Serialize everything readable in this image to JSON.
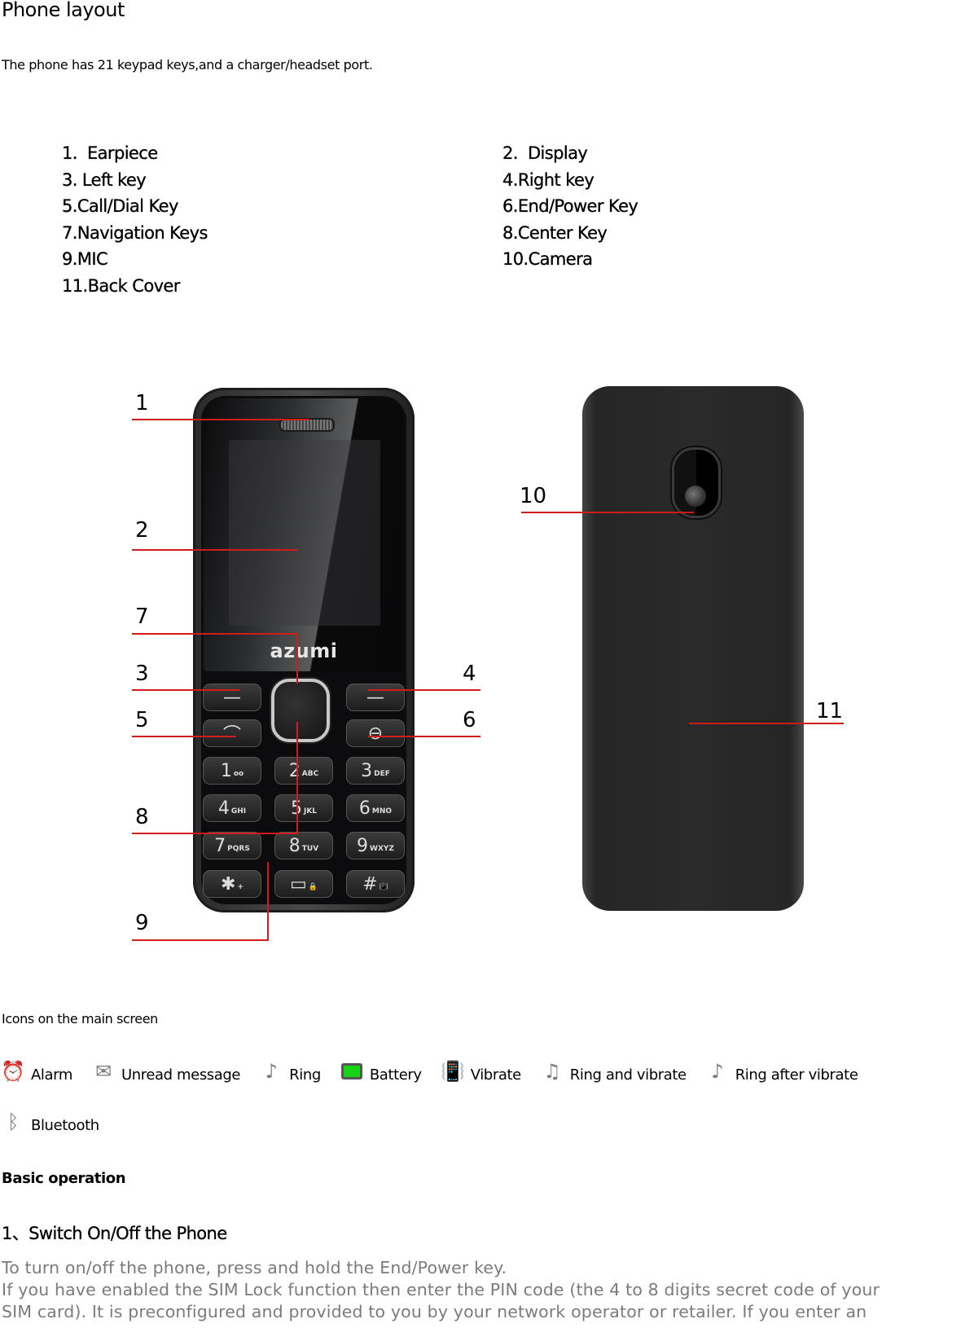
{
  "header": {
    "title": "Phone layout",
    "intro": "The phone has 21 keypad keys,and a charger/headset port."
  },
  "parts": {
    "left": [
      "1.  Earpiece",
      "3. Left key",
      "5.Call/Dial Key",
      "7.Navigation Keys",
      "9.MIC",
      "11.Back Cover"
    ],
    "right": [
      "2.  Display",
      "4.Right key",
      "6.End/Power Key",
      "8.Center Key",
      "10.Camera"
    ]
  },
  "figure": {
    "brand": "azumi",
    "callouts": [
      "1",
      "2",
      "7",
      "3",
      "4",
      "5",
      "6",
      "8",
      "9",
      "10",
      "11"
    ],
    "callout_color": "#d21c1c",
    "soft_keys": {
      "left_symbol": "—",
      "right_symbol": "—",
      "call_symbol": "⌒",
      "end_symbol": "⊖"
    },
    "keypad": [
      {
        "digit": "1",
        "letters": "oo"
      },
      {
        "digit": "2",
        "letters": "ABC"
      },
      {
        "digit": "3",
        "letters": "DEF"
      },
      {
        "digit": "4",
        "letters": "GHI"
      },
      {
        "digit": "5",
        "letters": "JKL"
      },
      {
        "digit": "6",
        "letters": "MNO"
      },
      {
        "digit": "7",
        "letters": "PQRS"
      },
      {
        "digit": "8",
        "letters": "TUV"
      },
      {
        "digit": "9",
        "letters": "WXYZ"
      },
      {
        "digit": "✱",
        "letters": "+"
      },
      {
        "digit": "▭",
        "letters": "🔒"
      },
      {
        "digit": "#",
        "letters": "📳"
      }
    ]
  },
  "icons_section": {
    "heading": "Icons on the main screen",
    "items": [
      {
        "icon": "alarm-icon",
        "glyph": "⏰",
        "label": "Alarm"
      },
      {
        "icon": "unread-message-icon",
        "glyph": "✉",
        "label": "Unread message"
      },
      {
        "icon": "ring-icon",
        "glyph": "♪",
        "label": "Ring"
      },
      {
        "icon": "battery-icon",
        "glyph": "",
        "label": "Battery",
        "color": "#15d315"
      },
      {
        "icon": "vibrate-icon",
        "glyph": "📳",
        "label": "Vibrate"
      },
      {
        "icon": "ring-and-vibrate-icon",
        "glyph": "♫",
        "label": "Ring and vibrate"
      },
      {
        "icon": "ring-after-vibrate-icon",
        "glyph": "♪",
        "label": "Ring after vibrate"
      }
    ],
    "bluetooth": {
      "icon": "bluetooth-icon",
      "glyph": "ᛒ",
      "label": "Bluetooth"
    }
  },
  "basic_operation": {
    "heading": "Basic operation",
    "step_title": "1、Switch On/Off the Phone",
    "lines": [
      "To turn on/off the phone, press and hold the End/Power key.",
      "If you have enabled the SIM Lock function then enter the PIN code (the 4 to 8 digits secret code of your",
      "SIM card). It is preconfigured and provided to you by your network operator or retailer. If you enter an"
    ],
    "text_color": "#7b7b7b"
  }
}
